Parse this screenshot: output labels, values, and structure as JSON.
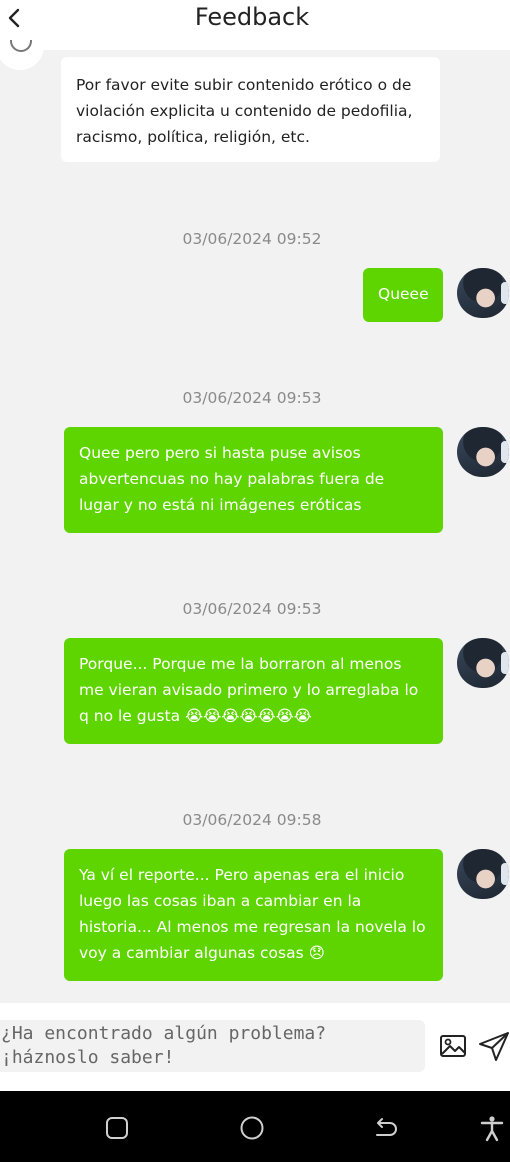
{
  "header": {
    "title": "Feedback",
    "back_icon": "chevron-left-icon"
  },
  "system_message": "Por favor evite subir contenido erótico o de violación explicita u contenido de pedofilia, racismo, política, religión, etc.",
  "messages": [
    {
      "timestamp": "03/06/2024 09:52",
      "text": "Queee"
    },
    {
      "timestamp": "03/06/2024 09:53",
      "text": "Quee pero pero si hasta puse avisos abvertencuas no hay palabras fuera de lugar y no está ni imágenes eróticas"
    },
    {
      "timestamp": "03/06/2024 09:53",
      "text": "Porque... Porque me la borraron al menos me vieran avisado primero y lo arreglaba lo q no le gusta 😭😭😭😭😭😭😭"
    },
    {
      "timestamp": "03/06/2024 09:58",
      "text": "Ya ví el reporte... Pero apenas era el inicio luego las cosas iban a cambiar en la historia... Al menos me regresan la novela lo voy a cambiar algunas cosas 😞"
    }
  ],
  "composer": {
    "placeholder": "¿Ha encontrado algún problema? ¡háznoslo saber!",
    "image_icon": "image-icon",
    "send_icon": "send-icon"
  },
  "colors": {
    "bubble_out": "#5fd500",
    "background": "#f2f2f2"
  },
  "navbar": {
    "icons": [
      "recents-square-icon",
      "home-circle-icon",
      "back-arrow-icon",
      "accessibility-icon"
    ]
  }
}
